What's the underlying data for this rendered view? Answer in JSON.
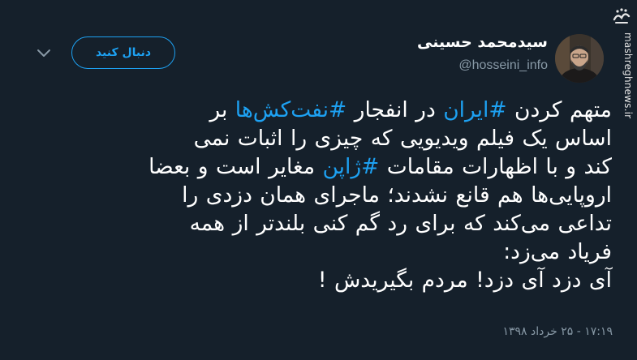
{
  "watermark": {
    "logo_text": "مشرق",
    "site": "mashreghnews.ir"
  },
  "user": {
    "display_name": "سیدمحمد حسینی",
    "handle": "@hosseini_info"
  },
  "follow_button": {
    "label": "دنبال کنید"
  },
  "tweet": {
    "line1": {
      "p1": "متهم کردن ",
      "tag1": "#ایران",
      "p2": " در انفجار ",
      "tag2": "#نفت‌کش‌ها",
      "p3": " بر"
    },
    "line2": "اساس یک فیلم ویدیویی که چیزی را اثبات نمی",
    "line3": {
      "p1": "کند و با اظهارات مقامات ",
      "tag1": "#ژاپن",
      "p2": " مغایر است و بعضا"
    },
    "line4": "اروپایی‌ها هم قانع نشدند؛ ماجرای همان دزدی را",
    "line5": "تداعی می‌کند که برای رد گم کنی بلندتر از همه",
    "line6": "فریاد می‌زد:",
    "line7": "آی دزد آی دزد! مردم بگیریدش !"
  },
  "timestamp": "۱۷:۱۹ - ۲۵ خرداد ۱۳۹۸",
  "colors": {
    "background": "#15202b",
    "accent": "#1da1f2",
    "muted": "#8899a6"
  }
}
